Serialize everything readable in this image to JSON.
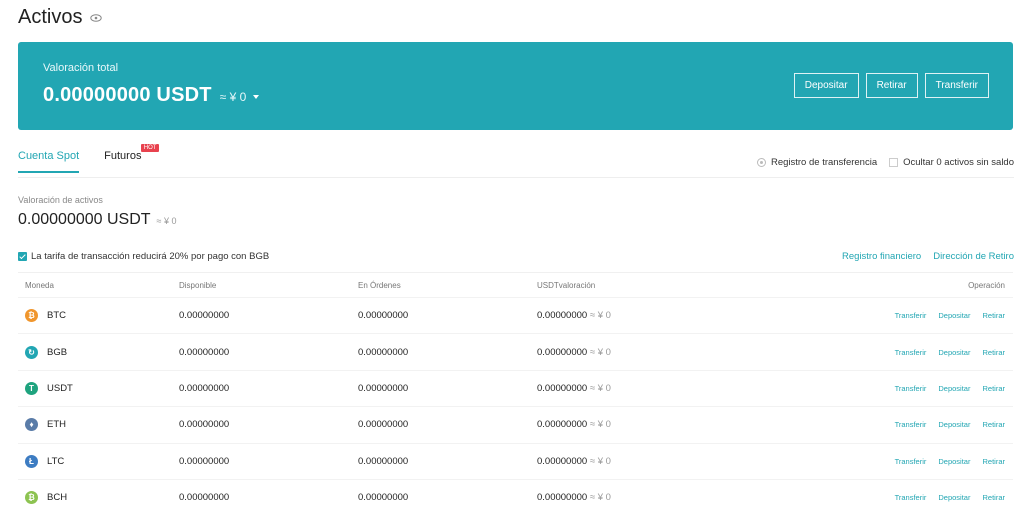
{
  "header": {
    "title": "Activos",
    "eye_icon": "eye-icon"
  },
  "banner": {
    "label": "Valoración total",
    "amount": "0.00000000 USDT",
    "fiat": "≈ ¥ 0",
    "caret_icon": "caret-down-icon",
    "buttons": [
      "Depositar",
      "Retirar",
      "Transferir"
    ],
    "color": "#22a6b3"
  },
  "tabs": [
    {
      "label": "Cuenta Spot",
      "active": true
    },
    {
      "label": "Futuros",
      "badge": "HOT"
    }
  ],
  "options": {
    "transfer_record": "Registro de transferencia",
    "hide_zero": "Ocultar 0 activos sin saldo"
  },
  "valuation": {
    "label": "Valoración de activos",
    "amount": "0.00000000 USDT",
    "fiat": "≈ ¥ 0"
  },
  "fee_notice": {
    "text": "La tarifa de transacción reducirá 20% por pago con BGB",
    "checked": true
  },
  "links": [
    "Registro financiero",
    "Dirección de Retiro"
  ],
  "table": {
    "columns": [
      "Moneda",
      "Disponible",
      "En Órdenes",
      "USDTvaloración",
      "Operación"
    ],
    "rows": [
      {
        "coin": "BTC",
        "icon": "btc-icon",
        "color": "#f0962d",
        "glyph": "₿",
        "available": "0.00000000",
        "orders": "0.00000000",
        "valuation": "0.00000000",
        "fiat": "≈ ¥ 0"
      },
      {
        "coin": "BGB",
        "icon": "bgb-icon",
        "color": "#22a6b3",
        "glyph": "↻",
        "available": "0.00000000",
        "orders": "0.00000000",
        "valuation": "0.00000000",
        "fiat": "≈ ¥ 0"
      },
      {
        "coin": "USDT",
        "icon": "usdt-icon",
        "color": "#1ea37e",
        "glyph": "T",
        "available": "0.00000000",
        "orders": "0.00000000",
        "valuation": "0.00000000",
        "fiat": "≈ ¥ 0"
      },
      {
        "coin": "ETH",
        "icon": "eth-icon",
        "color": "#5a7ca8",
        "glyph": "♦",
        "available": "0.00000000",
        "orders": "0.00000000",
        "valuation": "0.00000000",
        "fiat": "≈ ¥ 0"
      },
      {
        "coin": "LTC",
        "icon": "ltc-icon",
        "color": "#3d7cc2",
        "glyph": "Ł",
        "available": "0.00000000",
        "orders": "0.00000000",
        "valuation": "0.00000000",
        "fiat": "≈ ¥ 0"
      },
      {
        "coin": "BCH",
        "icon": "bch-icon",
        "color": "#8dc351",
        "glyph": "₿",
        "available": "0.00000000",
        "orders": "0.00000000",
        "valuation": "0.00000000",
        "fiat": "≈ ¥ 0"
      }
    ],
    "actions": [
      "Transferir",
      "Depositar",
      "Retirar"
    ]
  }
}
